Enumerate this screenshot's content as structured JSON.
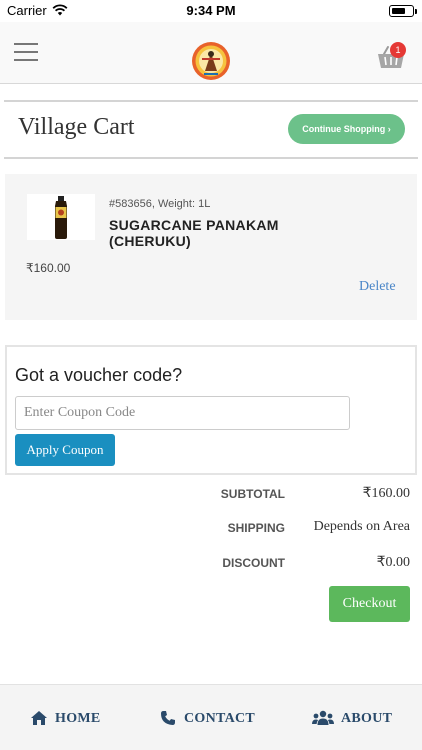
{
  "status_bar": {
    "carrier": "Carrier",
    "time": "9:34 PM",
    "battery_level": 0.7
  },
  "header": {
    "menu_icon": "hamburger-menu-icon",
    "logo_icon": "village-logo",
    "cart_icon": "shopping-basket-icon",
    "cart_count": "1"
  },
  "page": {
    "title": "Village Cart",
    "continue_label": "Continue Shopping ›"
  },
  "cart_items": [
    {
      "sku": "#583656",
      "weight": ", Weight: 1L",
      "name": "SUGARCANE PANAKAM (CHERUKU)",
      "price": "₹160.00",
      "delete_label": "Delete"
    }
  ],
  "voucher": {
    "title": "Got a voucher code?",
    "input_placeholder": "Enter Coupon Code",
    "input_value": "",
    "apply_label": "Apply Coupon"
  },
  "summary": {
    "subtotal_label": "SUBTOTAL",
    "subtotal_value": "₹160.00",
    "shipping_label": "SHIPPING",
    "shipping_value": "Depends on Area",
    "discount_label": "DISCOUNT",
    "discount_value": "₹0.00"
  },
  "checkout_label": "Checkout",
  "bottom_nav": {
    "home": {
      "label": "HOME",
      "icon": "home-icon"
    },
    "contact": {
      "label": "CONTACT",
      "icon": "phone-icon"
    },
    "about": {
      "label": "ABOUT",
      "icon": "users-icon"
    }
  },
  "colors": {
    "accent_green": "#6cc18a",
    "checkout_green": "#5cb85c",
    "apply_blue": "#1a8fc0",
    "badge_red": "#e53935",
    "nav_text": "#2a4a6a",
    "link_blue": "#4a86c8"
  }
}
